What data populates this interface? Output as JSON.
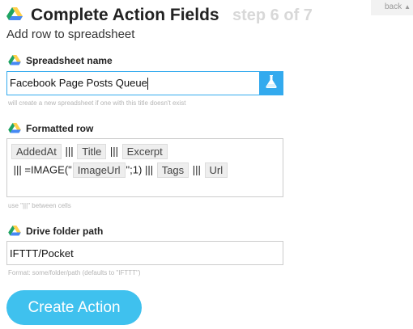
{
  "header": {
    "title": "Complete Action Fields",
    "step": "step 6 of 7",
    "back_label": "back",
    "back_arrow": "▲"
  },
  "subtitle": "Add row to spreadsheet",
  "fields": {
    "spreadsheet_name": {
      "label": "Spreadsheet name",
      "value": "Facebook Page Posts Queue",
      "hint": "will create a new spreadsheet if one with this title doesn't exist"
    },
    "formatted_row": {
      "label": "Formatted row",
      "parts": [
        {
          "type": "token",
          "text": "AddedAt"
        },
        {
          "type": "text",
          "text": " ||| "
        },
        {
          "type": "token",
          "text": "Title"
        },
        {
          "type": "text",
          "text": " ||| "
        },
        {
          "type": "token",
          "text": "Excerpt"
        },
        {
          "type": "text",
          "text": " ||| =IMAGE(\""
        },
        {
          "type": "token",
          "text": "ImageUrl"
        },
        {
          "type": "text",
          "text": "\";1) ||| "
        },
        {
          "type": "token",
          "text": "Tags"
        },
        {
          "type": "text",
          "text": " ||| "
        },
        {
          "type": "token",
          "text": "Url"
        }
      ],
      "hint": "use \"|||\" between cells"
    },
    "drive_folder_path": {
      "label": "Drive folder path",
      "value": "IFTTT/Pocket",
      "hint": "Format: some/folder/path (defaults to \"IFTTT\")"
    }
  },
  "create_button": "Create Action",
  "icons": {
    "drive": "google-drive-icon",
    "flask": "flask-icon"
  },
  "colors": {
    "accent": "#33aaee",
    "create_button": "#3fc1ee",
    "drive_green": "#1fa463",
    "drive_yellow": "#ffd04b",
    "drive_blue": "#4688f4"
  }
}
